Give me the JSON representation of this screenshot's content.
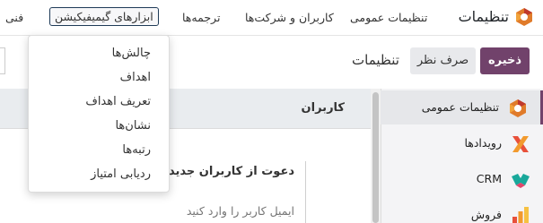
{
  "navbar": {
    "brand": "تنظیمات",
    "menu": [
      {
        "label": "تنظیمات عمومی"
      },
      {
        "label": "کاربران و شرکت‌ها"
      },
      {
        "label": "ترجمه‌ها"
      },
      {
        "label": "ابزارهای گیمیفیکیشن"
      },
      {
        "label": "فنی"
      }
    ]
  },
  "dropdown": {
    "items": [
      {
        "label": "چالش‌ها"
      },
      {
        "label": "اهداف"
      },
      {
        "label": "تعریف اهداف"
      },
      {
        "label": "نشان‌ها"
      },
      {
        "label": "رتبه‌ها"
      },
      {
        "label": "ردیابی امتیاز"
      }
    ]
  },
  "control_panel": {
    "save_label": "ذخیره",
    "discard_label": "صرف نظر",
    "title": "تنظیمات"
  },
  "sidebar": {
    "items": [
      {
        "label": "تنظیمات عمومی",
        "icon": "settings-app-icon",
        "active": true
      },
      {
        "label": "رویدادها",
        "icon": "events-app-icon"
      },
      {
        "label": "CRM",
        "icon": "crm-app-icon"
      },
      {
        "label": "فروش",
        "icon": "sales-app-icon"
      }
    ]
  },
  "content": {
    "section_title": "کاربران",
    "invite_title": "دعوت از کاربران جدید",
    "invite_placeholder": "ایمیل کاربر را وارد کنید"
  },
  "colors": {
    "accent": "#71426b",
    "focus_border": "#1f3b58"
  }
}
